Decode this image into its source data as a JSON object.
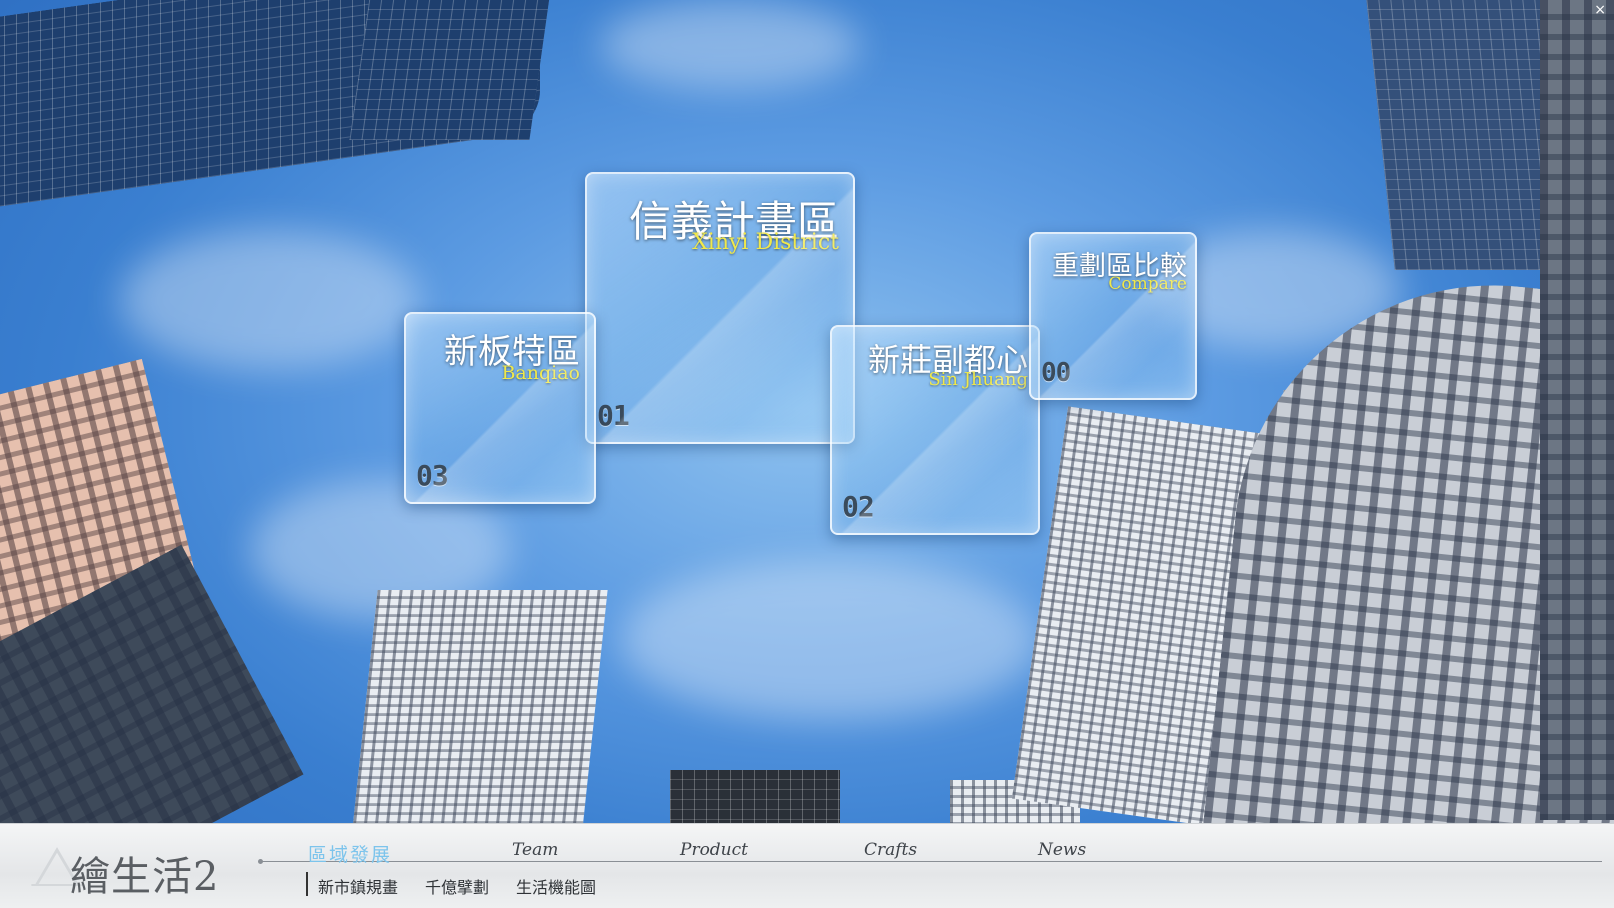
{
  "tiles": {
    "xinyi": {
      "zh": "信義計畫區",
      "en": "Xinyi District",
      "num": "01"
    },
    "sinjhuang": {
      "zh": "新莊副都心",
      "en": "Sin Jhuang",
      "num": "02"
    },
    "banqiao": {
      "zh": "新板特區",
      "en": "Banqiao",
      "num": "03"
    },
    "compare": {
      "zh": "重劃區比較",
      "en": "Compare",
      "num": "00"
    }
  },
  "footer": {
    "logo": "繪生活2",
    "nav": [
      {
        "label": "區域發展",
        "active": true
      },
      {
        "label": "Team",
        "active": false
      },
      {
        "label": "Product",
        "active": false
      },
      {
        "label": "Crafts",
        "active": false
      },
      {
        "label": "News",
        "active": false
      }
    ],
    "subnav": [
      "新市鎮規畫",
      "千億擘劃",
      "生活機能圖"
    ]
  },
  "window": {
    "close": "×"
  },
  "colors": {
    "accent_yellow": "#f0e84a",
    "nav_active": "#7cc4ec",
    "sky": "#5c9be2"
  }
}
